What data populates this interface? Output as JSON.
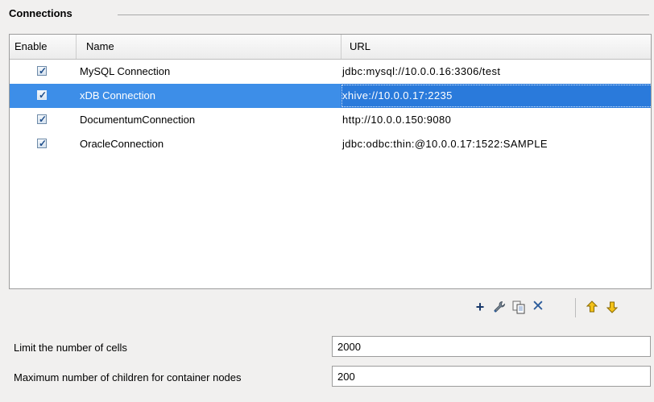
{
  "section": {
    "title": "Connections"
  },
  "table": {
    "headers": {
      "enable": "Enable",
      "name": "Name",
      "url": "URL"
    },
    "rows": [
      {
        "enabled": true,
        "name": "MySQL Connection",
        "url": "jdbc:mysql://10.0.0.16:3306/test",
        "selected": false
      },
      {
        "enabled": true,
        "name": "xDB Connection",
        "url": "xhive://10.0.0.17:2235",
        "selected": true
      },
      {
        "enabled": true,
        "name": "DocumentumConnection",
        "url": "http://10.0.0.150:9080",
        "selected": false
      },
      {
        "enabled": true,
        "name": "OracleConnection",
        "url": "jdbc:odbc:thin:@10.0.0.17:1522:SAMPLE",
        "selected": false
      }
    ]
  },
  "toolbar": {
    "icons": [
      "add-icon",
      "wrench-icon",
      "duplicate-icon",
      "delete-icon",
      "move-up-icon",
      "move-down-icon"
    ]
  },
  "settings": {
    "limit_cells_label": "Limit the number of cells",
    "limit_cells_value": "2000",
    "max_children_label": "Maximum number of children for container nodes",
    "max_children_value": "200"
  },
  "colors": {
    "selection": "#3d8ee8",
    "arrow": "#e8b400",
    "icon_blue": "#2a5a9a"
  }
}
